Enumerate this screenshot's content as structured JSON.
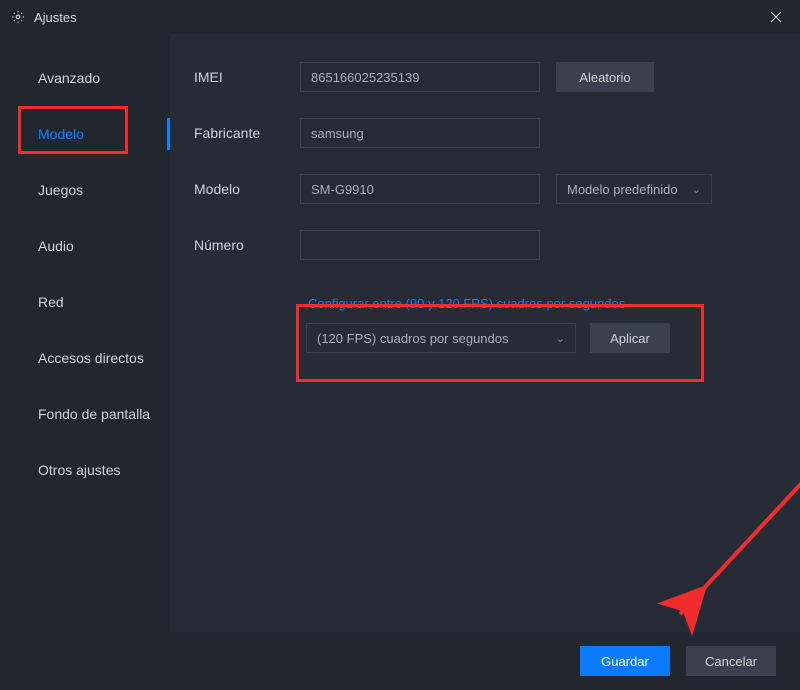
{
  "window": {
    "title": "Ajustes"
  },
  "sidebar": {
    "items": [
      {
        "label": "Avanzado"
      },
      {
        "label": "Modelo"
      },
      {
        "label": "Juegos"
      },
      {
        "label": "Audio"
      },
      {
        "label": "Red"
      },
      {
        "label": "Accesos directos"
      },
      {
        "label": "Fondo de pantalla"
      },
      {
        "label": "Otros ajustes"
      }
    ],
    "active_index": 1
  },
  "form": {
    "imei": {
      "label": "IMEI",
      "value": "865166025235139",
      "random_label": "Aleatorio"
    },
    "fabricante": {
      "label": "Fabricante",
      "value": "samsung"
    },
    "modelo": {
      "label": "Modelo",
      "value": "SM-G9910",
      "preset_label": "Modelo predefinido"
    },
    "numero": {
      "label": "Número",
      "value": ""
    }
  },
  "fps": {
    "title": "Configurar entre (90 y 120 FPS) cuadros por segundos",
    "selected": "(120 FPS) cuadros por segundos",
    "apply_label": "Aplicar"
  },
  "footer": {
    "save": "Guardar",
    "cancel": "Cancelar"
  }
}
